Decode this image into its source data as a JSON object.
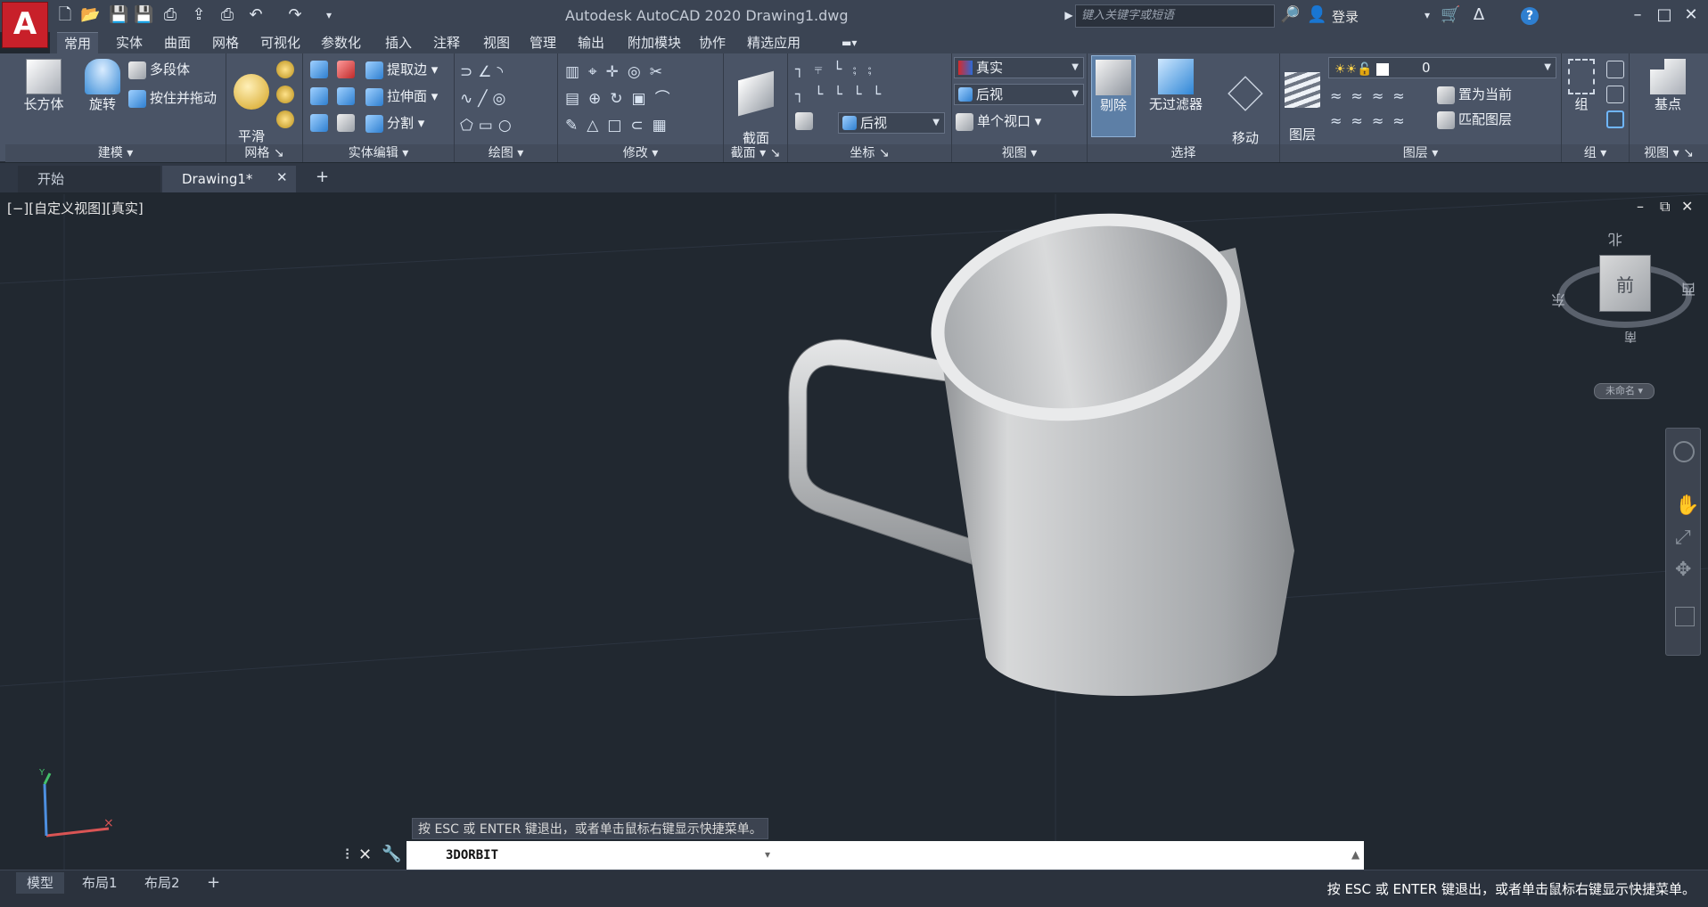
{
  "app": {
    "logo": "A",
    "title": "Autodesk AutoCAD 2020    Drawing1.dwg",
    "search_placeholder": "键入关键字或短语",
    "login_label": "登录",
    "help_label": "?"
  },
  "ribbon_tabs": [
    "常用",
    "实体",
    "曲面",
    "网格",
    "可视化",
    "参数化",
    "插入",
    "注释",
    "视图",
    "管理",
    "输出",
    "附加模块",
    "协作",
    "精选应用"
  ],
  "ribbon": {
    "modeling": {
      "title": "建模",
      "box": "长方体",
      "revolve": "旋转",
      "polysolid": "多段体",
      "presspull": "按住并拖动"
    },
    "mesh": {
      "title": "网格",
      "smooth": "平滑\n对象"
    },
    "solid_edit": {
      "title": "实体编辑",
      "extract": "提取边",
      "extrude": "拉伸面",
      "separate": "分割"
    },
    "draw": {
      "title": "绘图"
    },
    "modify": {
      "title": "修改"
    },
    "section": {
      "title": "截面",
      "plane": "截面\n平面"
    },
    "coords": {
      "title": "坐标",
      "view_value": "后视"
    },
    "view": {
      "title": "视图",
      "style": "真实",
      "view_name": "后视",
      "viewport": "单个视口"
    },
    "select": {
      "title": "选择",
      "cull": "剔除",
      "nofilter": "无过滤器",
      "gizmo": "移动\n小控件"
    },
    "layers": {
      "title": "图层",
      "layer_props": "图层\n特性",
      "current_layer": "0",
      "make_current": "置为当前",
      "match_layer": "匹配图层"
    },
    "groups": {
      "title": "组",
      "group": "组"
    },
    "view2": {
      "title": "视图",
      "base": "基点"
    }
  },
  "file_tabs": [
    {
      "label": "开始"
    },
    {
      "label": "Drawing1*"
    }
  ],
  "viewport": {
    "label": "[−][自定义视图][真实]",
    "viewcube": {
      "face": "前",
      "north": "北",
      "east": "东",
      "west": "西",
      "south": "南",
      "wcs_label": "未命名"
    },
    "hint": "按 ESC 或 ENTER 键退出，或者单击鼠标右键显示快捷菜单。"
  },
  "command": {
    "value": "3DORBIT"
  },
  "layout_tabs": [
    "模型",
    "布局1",
    "布局2"
  ],
  "status_message": "按 ESC 或 ENTER 键退出，或者单击鼠标右键显示快捷菜单。",
  "colors": {
    "app_red": "#c8202a",
    "ribbon": "#4a5466",
    "viewport": "#212830",
    "title": "#3b4453"
  }
}
